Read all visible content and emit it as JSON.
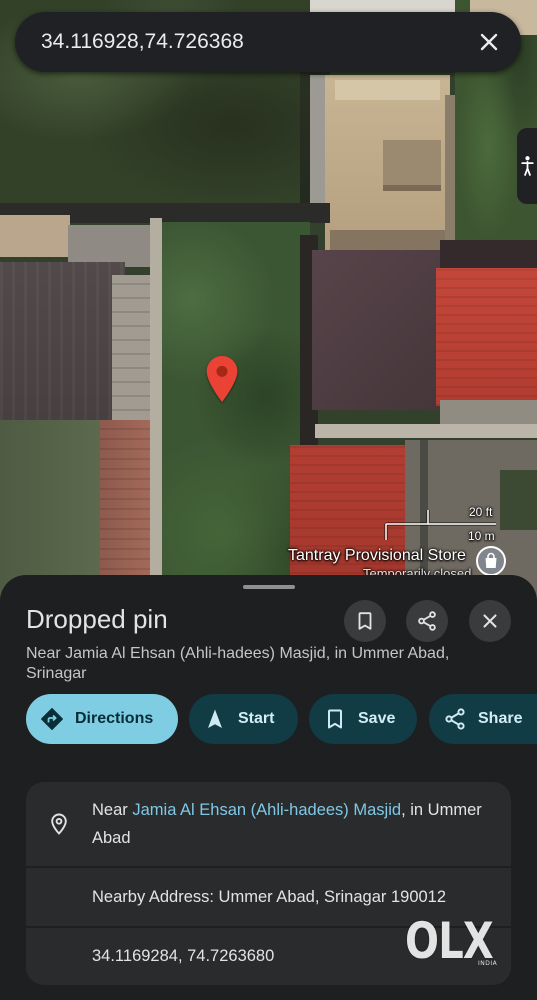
{
  "search": {
    "query": "34.116928,74.726368",
    "clear_icon": "close-icon"
  },
  "map": {
    "side_tab_icon": "street-view-icon",
    "pin_icon": "map-pin-icon",
    "scale": {
      "top_label": "20 ft",
      "bottom_label": "10 m"
    },
    "poi": {
      "name": "Tantray Provisional Store",
      "status": "Temporarily closed",
      "icon": "store-icon"
    }
  },
  "sheet": {
    "title": "Dropped pin",
    "subtitle": "Near Jamia Al Ehsan (Ahli-hadees) Masjid, in Ummer Abad, Srinagar",
    "header_buttons": [
      {
        "icon": "bookmark-icon"
      },
      {
        "icon": "share-icon"
      },
      {
        "icon": "close-icon"
      }
    ],
    "actions": [
      {
        "label": "Directions",
        "icon": "directions-icon"
      },
      {
        "label": "Start",
        "icon": "navigation-icon"
      },
      {
        "label": "Save",
        "icon": "bookmark-icon"
      },
      {
        "label": "Share",
        "icon": "share-icon"
      }
    ],
    "details": {
      "near_icon": "location-pin-icon",
      "near_prefix": "Near ",
      "near_link": "Jamia Al Ehsan (Ahli-hadees) Masjid",
      "near_suffix": ", in Ummer Abad",
      "nearby_address": "Nearby Address: Ummer Abad, Srinagar 190012",
      "coordinates": "34.1169284, 74.7263680"
    }
  },
  "watermark": {
    "logo": "OLX",
    "region": "INDIA"
  },
  "colors": {
    "primary_button": "#7fcde2",
    "tonal_button": "#113b45",
    "link": "#7fc8e6",
    "pin": "#ea4335",
    "sheet": "#1e1f20",
    "card": "#2a2b2d"
  }
}
